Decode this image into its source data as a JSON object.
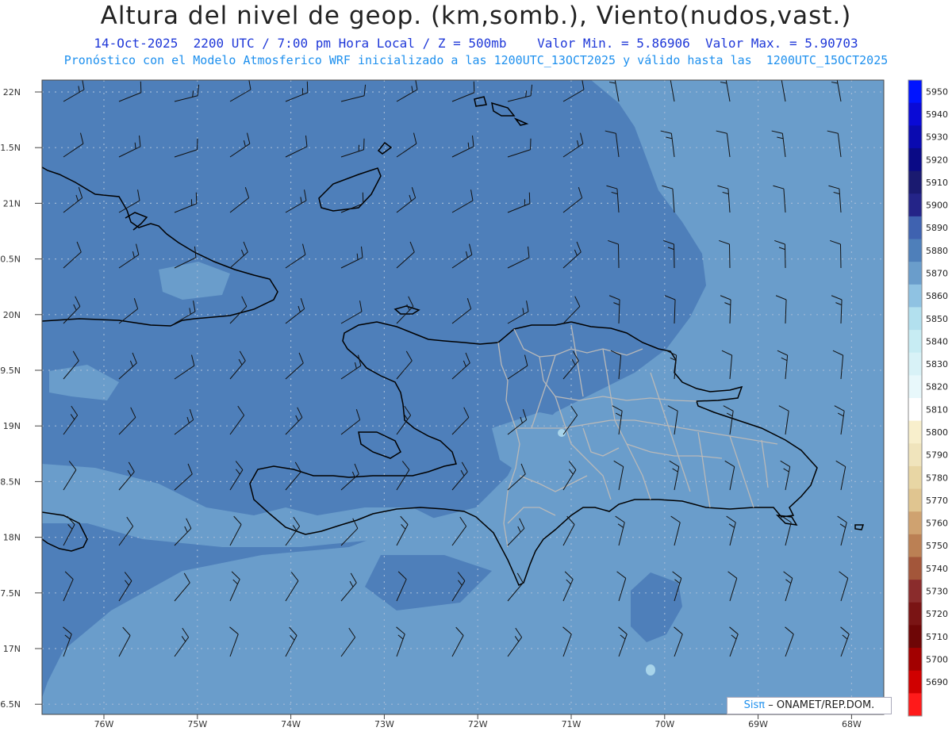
{
  "header": {
    "title": "Altura del nivel de geop. (km,somb.), Viento(nudos,vast.)",
    "line2": "14-Oct-2025  2200 UTC / 7:00 pm Hora Local / Z = 500mb    Valor Min. = 5.86906  Valor Max. = 5.90703",
    "line3": "Pronóstico con el Modelo Atmosferico WRF inicializado a las 1200UTC_13OCT2025 y válido hasta las  1200UTC_15OCT2025"
  },
  "map": {
    "lat_labels": [
      "22N",
      "1.5N",
      "21N",
      "0.5N",
      "20N",
      "9.5N",
      "19N",
      "8.5N",
      "18N",
      "7.5N",
      "17N",
      "6.5N"
    ],
    "lon_labels": [
      "76W",
      "75W",
      "74W",
      "73W",
      "72W",
      "71W",
      "70W",
      "69W",
      "68W"
    ],
    "grid": true,
    "colors": {
      "field_main": "#4e7fba",
      "field_light": "#6a9dcb",
      "field_lighter": "#86b6da",
      "field_pale": "#a8d4ea",
      "coast": "#000000",
      "provinces": "#b9b9b9"
    }
  },
  "colorbar": {
    "levels": [
      "5950",
      "5940",
      "5930",
      "5920",
      "5910",
      "5900",
      "5890",
      "5880",
      "5870",
      "5860",
      "5850",
      "5840",
      "5830",
      "5820",
      "5810",
      "5800",
      "5790",
      "5780",
      "5770",
      "5760",
      "5750",
      "5740",
      "5730",
      "5720",
      "5710",
      "5700",
      "5690"
    ],
    "colors": [
      "#0014ff",
      "#0a0ad6",
      "#0a0ab0",
      "#0a0a86",
      "#1a1a70",
      "#242488",
      "#3f62b0",
      "#4e7fba",
      "#6a9dcb",
      "#8fc2e2",
      "#b2e0ee",
      "#c7ecf3",
      "#d8f2f7",
      "#e8f8fb",
      "#ffffff",
      "#f8efcc",
      "#f0e4bc",
      "#e8d6a4",
      "#e0c590",
      "#cfa270",
      "#bb8054",
      "#a3563a",
      "#8a2c2c",
      "#7a1414",
      "#6e0606",
      "#a20000",
      "#d00000",
      "#ff1a1a"
    ]
  },
  "footer": {
    "credit_sis": "Sisπ",
    "credit_rest": "– ONAMET/REP.DOM."
  }
}
